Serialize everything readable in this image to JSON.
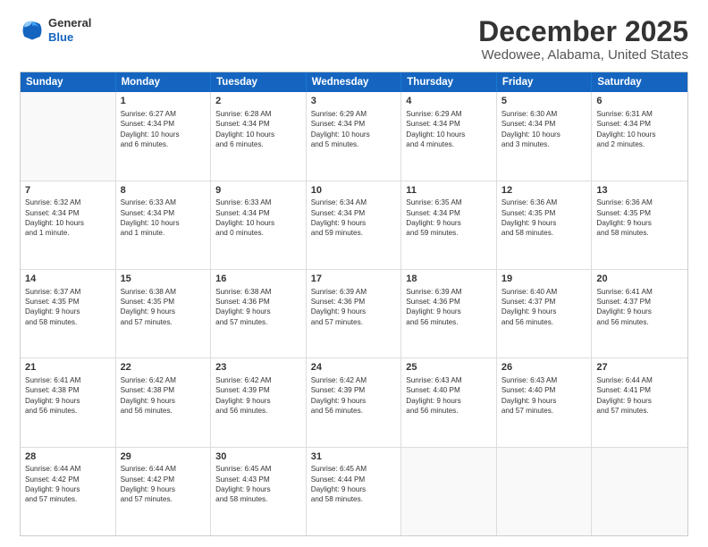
{
  "logo": {
    "general": "General",
    "blue": "Blue"
  },
  "header": {
    "title": "December 2025",
    "subtitle": "Wedowee, Alabama, United States"
  },
  "calendar": {
    "days": [
      "Sunday",
      "Monday",
      "Tuesday",
      "Wednesday",
      "Thursday",
      "Friday",
      "Saturday"
    ],
    "rows": [
      [
        {
          "day": "",
          "empty": true,
          "lines": []
        },
        {
          "day": "1",
          "empty": false,
          "lines": [
            "Sunrise: 6:27 AM",
            "Sunset: 4:34 PM",
            "Daylight: 10 hours",
            "and 6 minutes."
          ]
        },
        {
          "day": "2",
          "empty": false,
          "lines": [
            "Sunrise: 6:28 AM",
            "Sunset: 4:34 PM",
            "Daylight: 10 hours",
            "and 6 minutes."
          ]
        },
        {
          "day": "3",
          "empty": false,
          "lines": [
            "Sunrise: 6:29 AM",
            "Sunset: 4:34 PM",
            "Daylight: 10 hours",
            "and 5 minutes."
          ]
        },
        {
          "day": "4",
          "empty": false,
          "lines": [
            "Sunrise: 6:29 AM",
            "Sunset: 4:34 PM",
            "Daylight: 10 hours",
            "and 4 minutes."
          ]
        },
        {
          "day": "5",
          "empty": false,
          "lines": [
            "Sunrise: 6:30 AM",
            "Sunset: 4:34 PM",
            "Daylight: 10 hours",
            "and 3 minutes."
          ]
        },
        {
          "day": "6",
          "empty": false,
          "lines": [
            "Sunrise: 6:31 AM",
            "Sunset: 4:34 PM",
            "Daylight: 10 hours",
            "and 2 minutes."
          ]
        }
      ],
      [
        {
          "day": "7",
          "empty": false,
          "lines": [
            "Sunrise: 6:32 AM",
            "Sunset: 4:34 PM",
            "Daylight: 10 hours",
            "and 1 minute."
          ]
        },
        {
          "day": "8",
          "empty": false,
          "lines": [
            "Sunrise: 6:33 AM",
            "Sunset: 4:34 PM",
            "Daylight: 10 hours",
            "and 1 minute."
          ]
        },
        {
          "day": "9",
          "empty": false,
          "lines": [
            "Sunrise: 6:33 AM",
            "Sunset: 4:34 PM",
            "Daylight: 10 hours",
            "and 0 minutes."
          ]
        },
        {
          "day": "10",
          "empty": false,
          "lines": [
            "Sunrise: 6:34 AM",
            "Sunset: 4:34 PM",
            "Daylight: 9 hours",
            "and 59 minutes."
          ]
        },
        {
          "day": "11",
          "empty": false,
          "lines": [
            "Sunrise: 6:35 AM",
            "Sunset: 4:34 PM",
            "Daylight: 9 hours",
            "and 59 minutes."
          ]
        },
        {
          "day": "12",
          "empty": false,
          "lines": [
            "Sunrise: 6:36 AM",
            "Sunset: 4:35 PM",
            "Daylight: 9 hours",
            "and 58 minutes."
          ]
        },
        {
          "day": "13",
          "empty": false,
          "lines": [
            "Sunrise: 6:36 AM",
            "Sunset: 4:35 PM",
            "Daylight: 9 hours",
            "and 58 minutes."
          ]
        }
      ],
      [
        {
          "day": "14",
          "empty": false,
          "lines": [
            "Sunrise: 6:37 AM",
            "Sunset: 4:35 PM",
            "Daylight: 9 hours",
            "and 58 minutes."
          ]
        },
        {
          "day": "15",
          "empty": false,
          "lines": [
            "Sunrise: 6:38 AM",
            "Sunset: 4:35 PM",
            "Daylight: 9 hours",
            "and 57 minutes."
          ]
        },
        {
          "day": "16",
          "empty": false,
          "lines": [
            "Sunrise: 6:38 AM",
            "Sunset: 4:36 PM",
            "Daylight: 9 hours",
            "and 57 minutes."
          ]
        },
        {
          "day": "17",
          "empty": false,
          "lines": [
            "Sunrise: 6:39 AM",
            "Sunset: 4:36 PM",
            "Daylight: 9 hours",
            "and 57 minutes."
          ]
        },
        {
          "day": "18",
          "empty": false,
          "lines": [
            "Sunrise: 6:39 AM",
            "Sunset: 4:36 PM",
            "Daylight: 9 hours",
            "and 56 minutes."
          ]
        },
        {
          "day": "19",
          "empty": false,
          "lines": [
            "Sunrise: 6:40 AM",
            "Sunset: 4:37 PM",
            "Daylight: 9 hours",
            "and 56 minutes."
          ]
        },
        {
          "day": "20",
          "empty": false,
          "lines": [
            "Sunrise: 6:41 AM",
            "Sunset: 4:37 PM",
            "Daylight: 9 hours",
            "and 56 minutes."
          ]
        }
      ],
      [
        {
          "day": "21",
          "empty": false,
          "lines": [
            "Sunrise: 6:41 AM",
            "Sunset: 4:38 PM",
            "Daylight: 9 hours",
            "and 56 minutes."
          ]
        },
        {
          "day": "22",
          "empty": false,
          "lines": [
            "Sunrise: 6:42 AM",
            "Sunset: 4:38 PM",
            "Daylight: 9 hours",
            "and 56 minutes."
          ]
        },
        {
          "day": "23",
          "empty": false,
          "lines": [
            "Sunrise: 6:42 AM",
            "Sunset: 4:39 PM",
            "Daylight: 9 hours",
            "and 56 minutes."
          ]
        },
        {
          "day": "24",
          "empty": false,
          "lines": [
            "Sunrise: 6:42 AM",
            "Sunset: 4:39 PM",
            "Daylight: 9 hours",
            "and 56 minutes."
          ]
        },
        {
          "day": "25",
          "empty": false,
          "lines": [
            "Sunrise: 6:43 AM",
            "Sunset: 4:40 PM",
            "Daylight: 9 hours",
            "and 56 minutes."
          ]
        },
        {
          "day": "26",
          "empty": false,
          "lines": [
            "Sunrise: 6:43 AM",
            "Sunset: 4:40 PM",
            "Daylight: 9 hours",
            "and 57 minutes."
          ]
        },
        {
          "day": "27",
          "empty": false,
          "lines": [
            "Sunrise: 6:44 AM",
            "Sunset: 4:41 PM",
            "Daylight: 9 hours",
            "and 57 minutes."
          ]
        }
      ],
      [
        {
          "day": "28",
          "empty": false,
          "lines": [
            "Sunrise: 6:44 AM",
            "Sunset: 4:42 PM",
            "Daylight: 9 hours",
            "and 57 minutes."
          ]
        },
        {
          "day": "29",
          "empty": false,
          "lines": [
            "Sunrise: 6:44 AM",
            "Sunset: 4:42 PM",
            "Daylight: 9 hours",
            "and 57 minutes."
          ]
        },
        {
          "day": "30",
          "empty": false,
          "lines": [
            "Sunrise: 6:45 AM",
            "Sunset: 4:43 PM",
            "Daylight: 9 hours",
            "and 58 minutes."
          ]
        },
        {
          "day": "31",
          "empty": false,
          "lines": [
            "Sunrise: 6:45 AM",
            "Sunset: 4:44 PM",
            "Daylight: 9 hours",
            "and 58 minutes."
          ]
        },
        {
          "day": "",
          "empty": true,
          "lines": []
        },
        {
          "day": "",
          "empty": true,
          "lines": []
        },
        {
          "day": "",
          "empty": true,
          "lines": []
        }
      ]
    ]
  }
}
